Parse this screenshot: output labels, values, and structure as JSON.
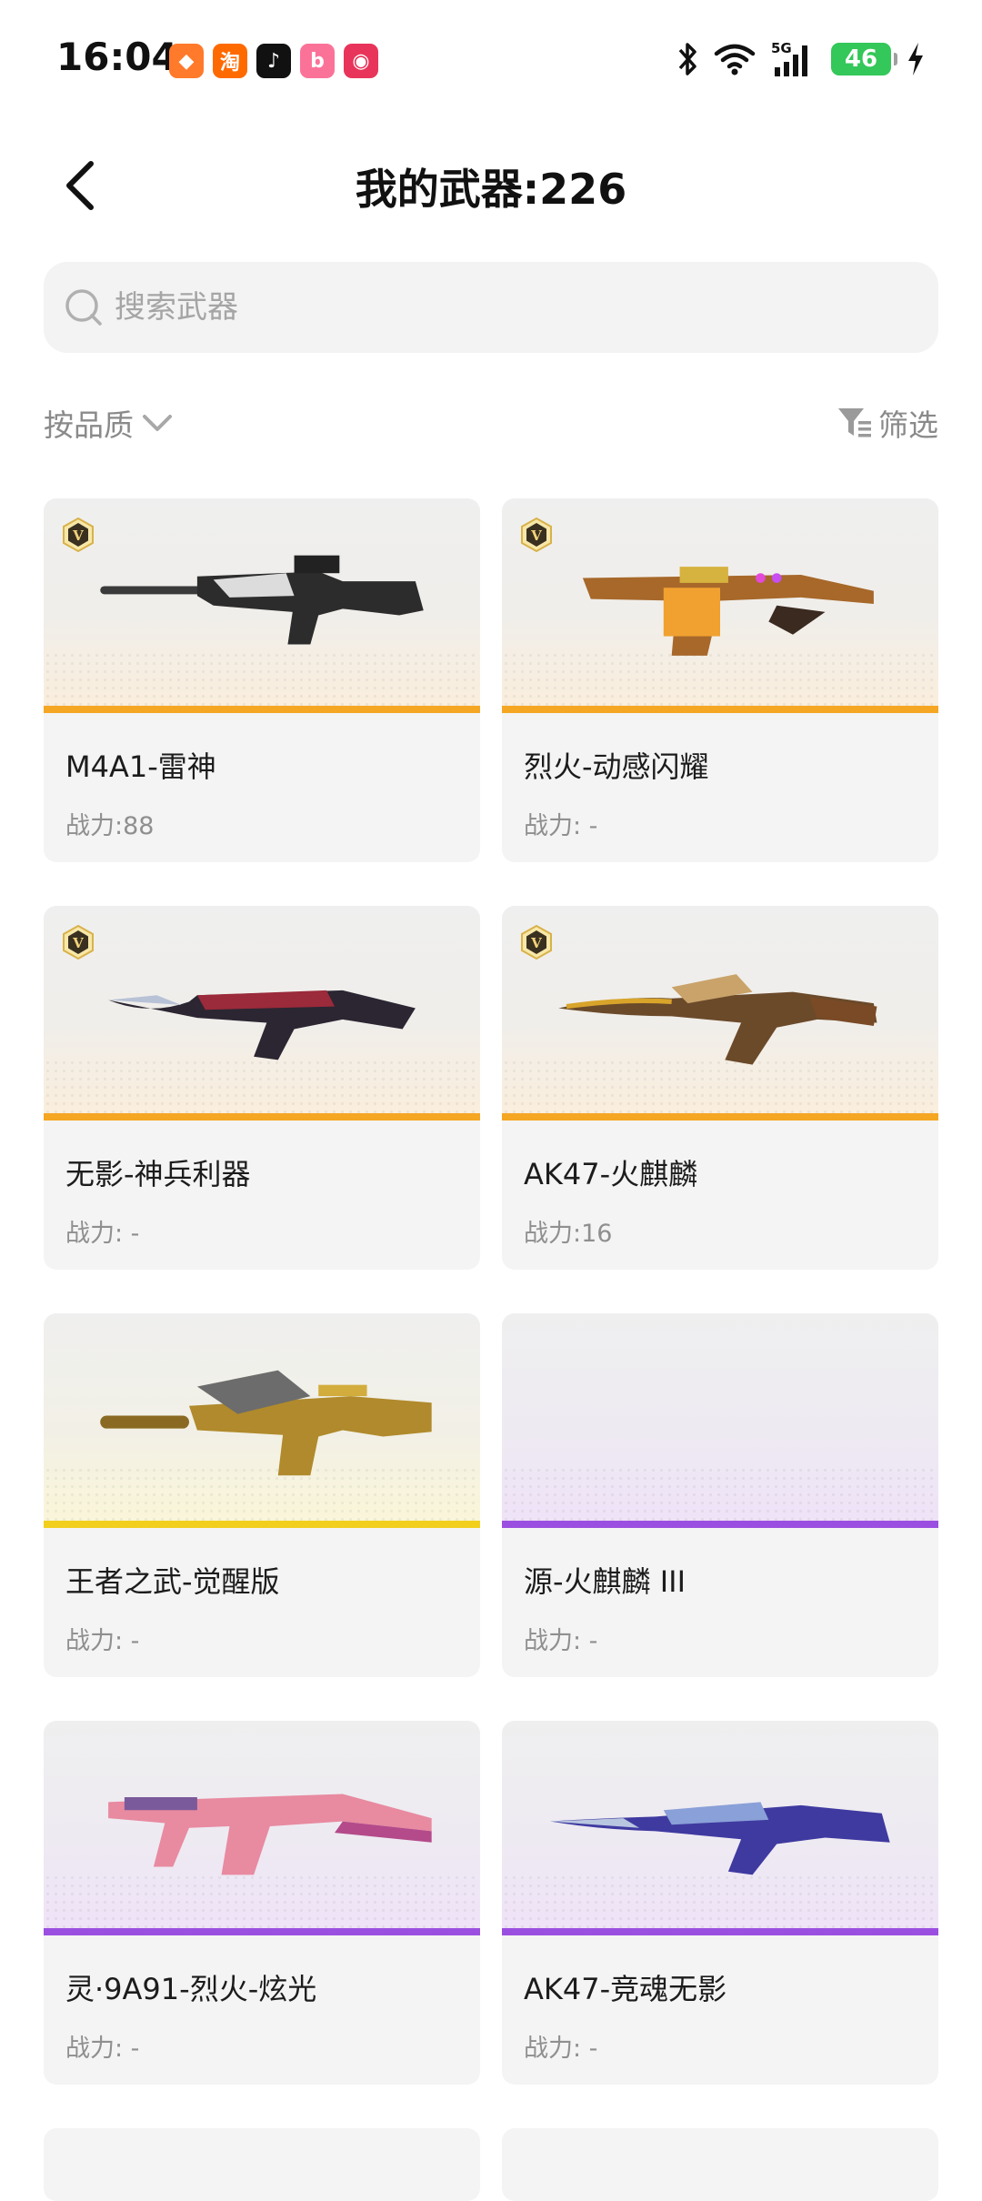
{
  "status_bar": {
    "time": "16:04",
    "battery": "46",
    "notifications": [
      {
        "icon": "app-generic-icon",
        "color": "#ff7a2a",
        "glyph": "◆"
      },
      {
        "icon": "taobao-icon",
        "color": "#ff6a00",
        "glyph": "淘"
      },
      {
        "icon": "douyin-icon",
        "color": "#111111",
        "glyph": "♪"
      },
      {
        "icon": "bilibili-icon",
        "color": "#fb7299",
        "glyph": "b"
      },
      {
        "icon": "app-pink-icon",
        "color": "#e8345a",
        "glyph": "◉"
      }
    ]
  },
  "header": {
    "title": "我的武器:226"
  },
  "search": {
    "placeholder": "搜索武器"
  },
  "filters": {
    "sort_label": "按品质",
    "filter_label": "筛选"
  },
  "colors": {
    "orange": "#f5a623",
    "yellow": "#f2cf1d",
    "purple": "#9b4fe0"
  },
  "weapons": [
    {
      "name": "M4A1-雷神",
      "power": "战力:88",
      "vip": true,
      "quality": "orange",
      "weapon_icon": "rifle-icon"
    },
    {
      "name": "烈火-动感闪耀",
      "power": "战力: -",
      "vip": true,
      "quality": "orange",
      "weapon_icon": "smg-icon"
    },
    {
      "name": "无影-神兵利器",
      "power": "战力: -",
      "vip": true,
      "quality": "orange",
      "weapon_icon": "ak-blade-icon"
    },
    {
      "name": "AK47-火麒麟",
      "power": "战力:16",
      "vip": true,
      "quality": "orange",
      "weapon_icon": "ak-gold-icon"
    },
    {
      "name": "王者之武-觉醒版",
      "power": "战力: -",
      "vip": false,
      "quality": "yellow",
      "weapon_icon": "rifle-gold-icon"
    },
    {
      "name": "源-火麒麟 III",
      "power": "战力: -",
      "vip": false,
      "quality": "purple",
      "weapon_icon": ""
    },
    {
      "name": "灵·9A91-烈火-炫光",
      "power": "战力: -",
      "vip": false,
      "quality": "purple",
      "weapon_icon": "smg-pink-icon"
    },
    {
      "name": "AK47-竞魂无影",
      "power": "战力: -",
      "vip": false,
      "quality": "purple",
      "weapon_icon": "ak-blue-icon"
    }
  ]
}
